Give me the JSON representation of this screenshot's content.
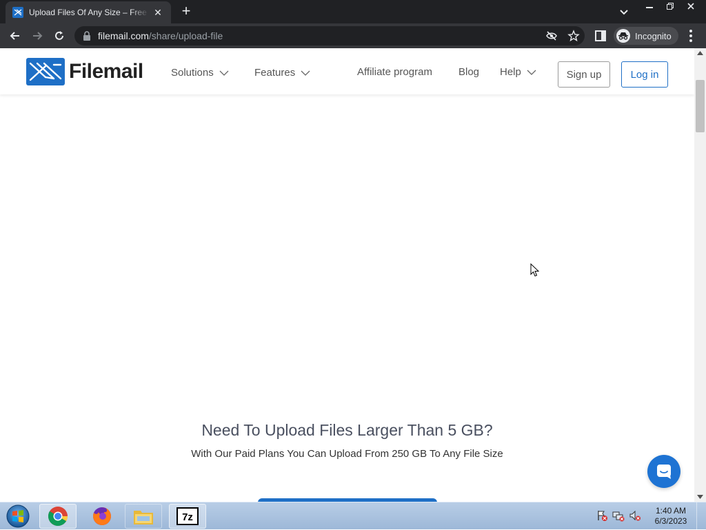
{
  "browser": {
    "tab_title": "Upload Files Of Any Size – Free Upload",
    "tab_close": "✕",
    "new_tab": "+",
    "url_host": "filemail.com",
    "url_path": "/share/upload-file",
    "incognito_label": "Incognito"
  },
  "site": {
    "logo_text": "Filemail",
    "nav": {
      "solutions": "Solutions",
      "features": "Features",
      "affiliate": "Affiliate program",
      "blog": "Blog",
      "help": "Help"
    },
    "signup_label": "Sign up",
    "login_label": "Log in",
    "brand_color": "#1e6fc6"
  },
  "promo": {
    "title": "Need To Upload Files Larger Than 5 GB?",
    "subtitle": "With Our Paid Plans You Can Upload From 250 GB To Any File Size"
  },
  "taskbar": {
    "time": "1:40 AM",
    "date": "6/3/2023",
    "apps": [
      "chrome-icon",
      "firefox-icon",
      "file-explorer-icon",
      "7zip-icon"
    ],
    "seven_zip_label": "7z"
  }
}
